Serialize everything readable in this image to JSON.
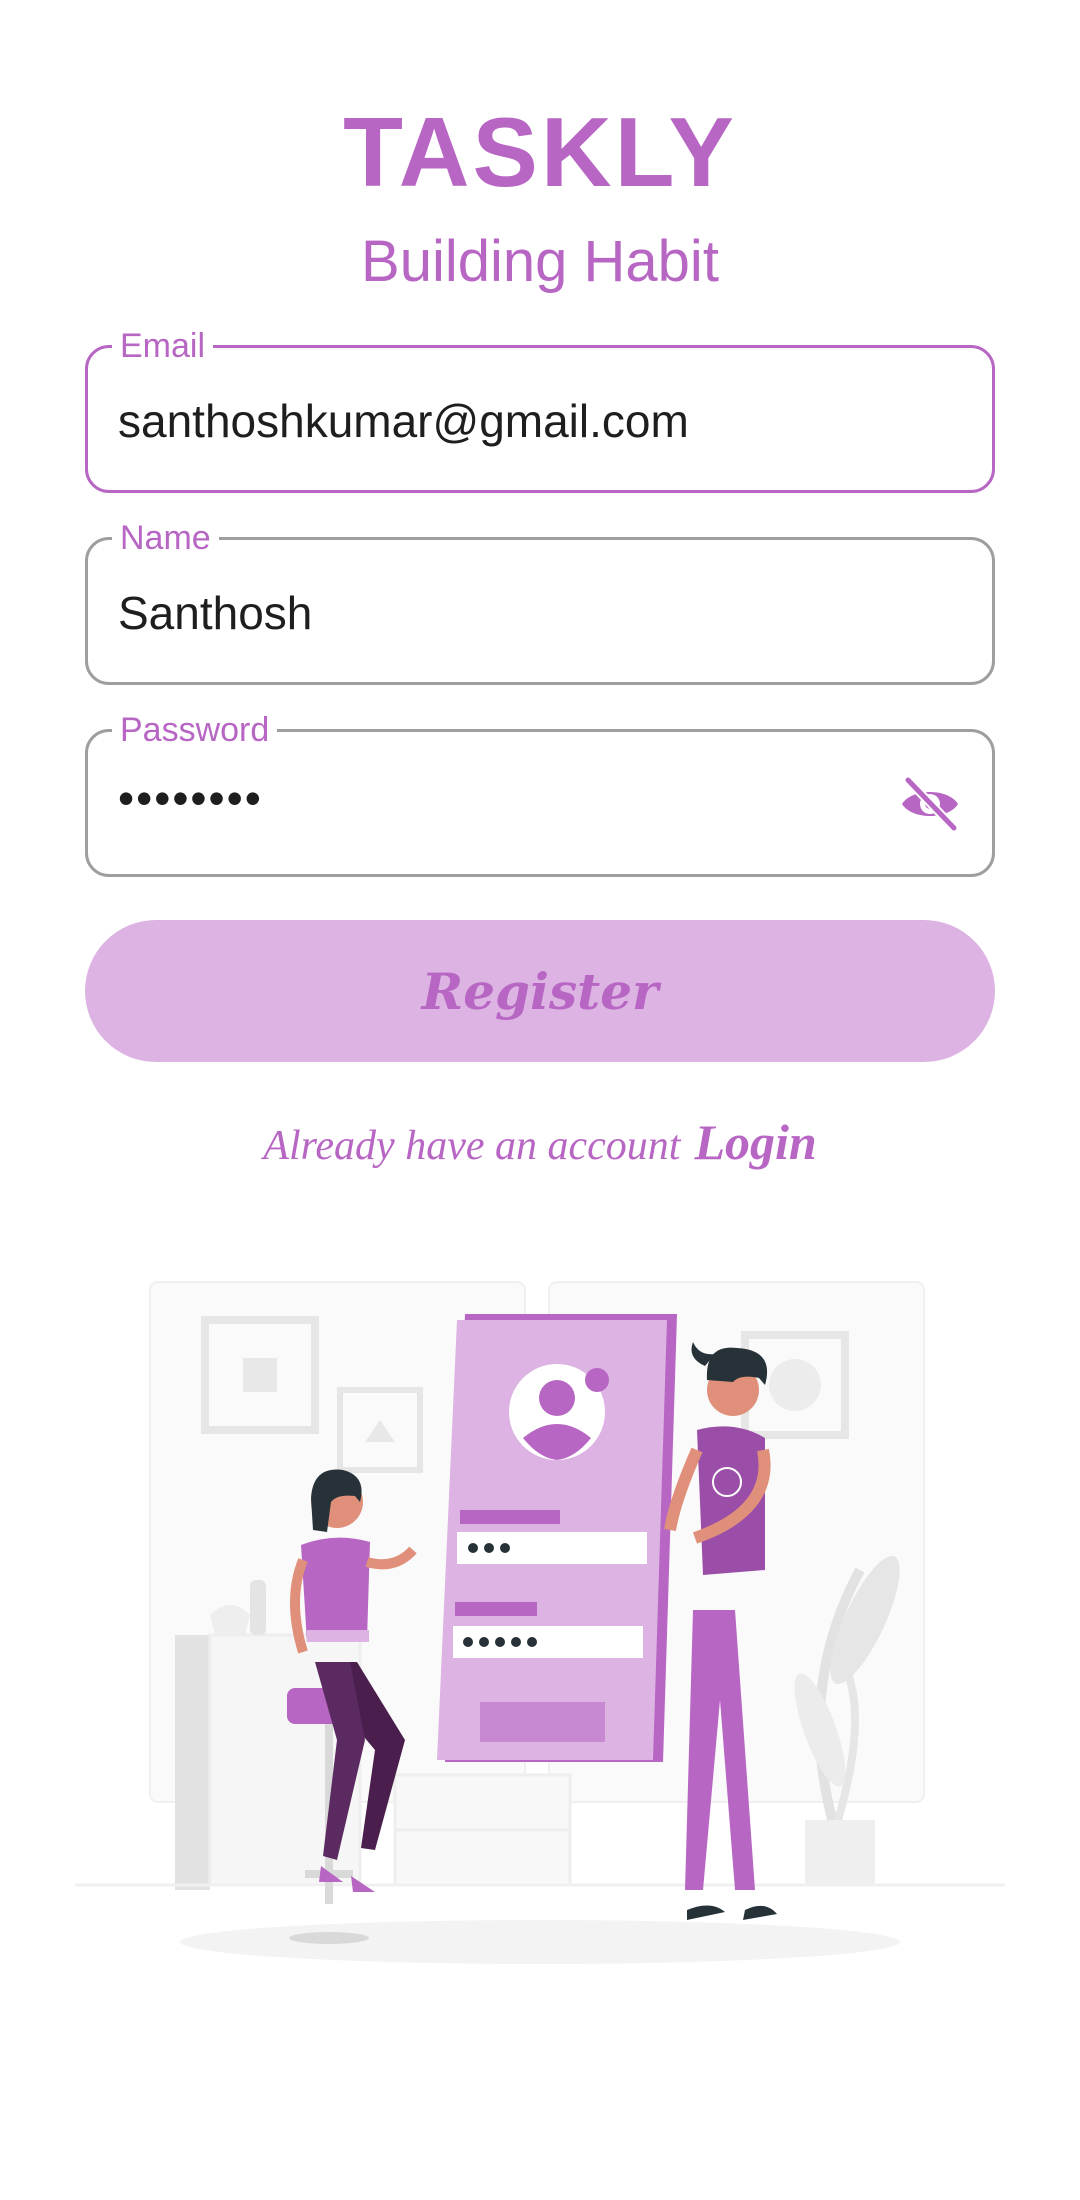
{
  "app": {
    "title": "TASKLY",
    "subtitle": "Building Habit"
  },
  "form": {
    "email": {
      "label": "Email",
      "value": "santhoshkumar@gmail.com"
    },
    "name": {
      "label": "Name",
      "value": "Santhosh"
    },
    "password": {
      "label": "Password",
      "value": "••••••••",
      "visibility_icon": "eye-off-icon"
    },
    "register_label": "Register"
  },
  "footer": {
    "prompt": "Already have an account",
    "login_label": "Login"
  },
  "theme": {
    "accent": "#b766c3",
    "button_bg": "#dcb3e2",
    "border_idle": "#9e9e9e",
    "text": "#1e1e1e"
  },
  "illustration": {
    "semantic": "registration-illustration"
  }
}
